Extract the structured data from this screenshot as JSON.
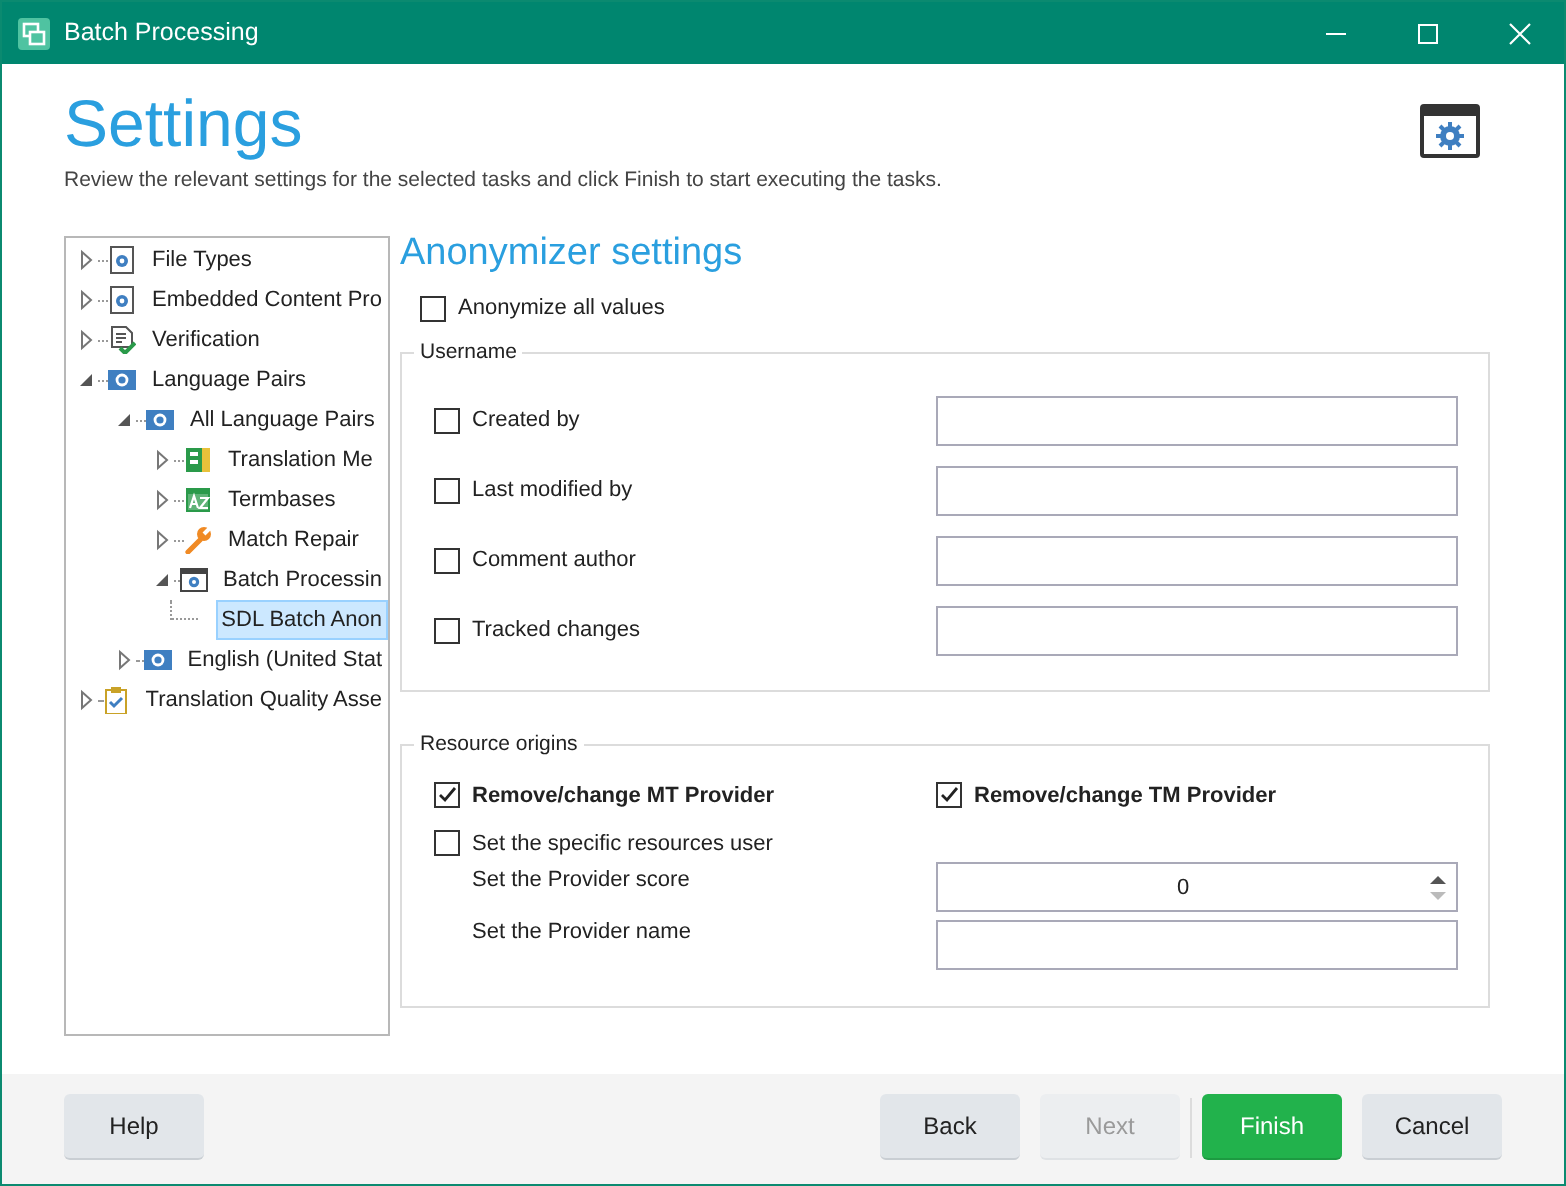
{
  "window": {
    "title": "Batch Processing"
  },
  "header": {
    "title": "Settings",
    "subtitle": "Review the relevant settings for the selected tasks and click Finish to start executing the tasks."
  },
  "tree": [
    {
      "label": "File Types",
      "kind": "settings",
      "expanded": false,
      "selected": false
    },
    {
      "label": "Embedded Content Pro",
      "kind": "settings",
      "expanded": false,
      "selected": false
    },
    {
      "label": "Verification",
      "kind": "verification",
      "expanded": false,
      "selected": false
    },
    {
      "label": "Language Pairs",
      "kind": "language",
      "expanded": true,
      "selected": false,
      "children": [
        {
          "label": "All Language Pairs",
          "kind": "language",
          "expanded": true,
          "selected": false,
          "children": [
            {
              "label": "Translation Me",
              "kind": "memory",
              "expanded": false,
              "selected": false
            },
            {
              "label": "Termbases",
              "kind": "termbase",
              "expanded": false,
              "selected": false
            },
            {
              "label": "Match Repair",
              "kind": "repair",
              "expanded": false,
              "selected": false
            },
            {
              "label": "Batch Processin",
              "kind": "batch",
              "expanded": true,
              "selected": false,
              "children": [
                {
                  "label": "SDL Batch Anon",
                  "selected": true
                }
              ]
            }
          ]
        },
        {
          "label": "English (United Stat",
          "kind": "language",
          "expanded": false,
          "selected": false
        }
      ]
    },
    {
      "label": "Translation Quality Asse",
      "kind": "quality",
      "expanded": false,
      "selected": false
    }
  ],
  "panel": {
    "title": "Anonymizer settings",
    "anonymize_all": {
      "label": "Anonymize all values",
      "checked": false
    },
    "username": {
      "title": "Username",
      "rows": [
        {
          "label": "Created by",
          "checked": false
        },
        {
          "label": "Last modified by",
          "checked": false
        },
        {
          "label": "Comment author",
          "checked": false
        },
        {
          "label": "Tracked changes",
          "checked": false
        }
      ]
    },
    "resource_origins": {
      "title": "Resource origins",
      "providers": [
        {
          "label": "Remove/change MT Provider",
          "checked": true
        },
        {
          "label": "Remove/change TM Provider",
          "checked": true
        }
      ],
      "specific_user": {
        "label": "Set the specific resources user",
        "checked": false
      },
      "score": {
        "label": "Set the Provider score",
        "value": "0"
      },
      "name": {
        "label": "Set the Provider name"
      }
    }
  },
  "footer": {
    "buttons": [
      {
        "label": "Help",
        "kind": "help",
        "disabled": false
      },
      {
        "label": "Back",
        "kind": "secondary",
        "disabled": false
      },
      {
        "label": "Next",
        "kind": "secondary",
        "disabled": true
      },
      {
        "label": "Finish",
        "kind": "primary",
        "disabled": false
      },
      {
        "label": "Cancel",
        "kind": "secondary",
        "disabled": false
      }
    ]
  }
}
